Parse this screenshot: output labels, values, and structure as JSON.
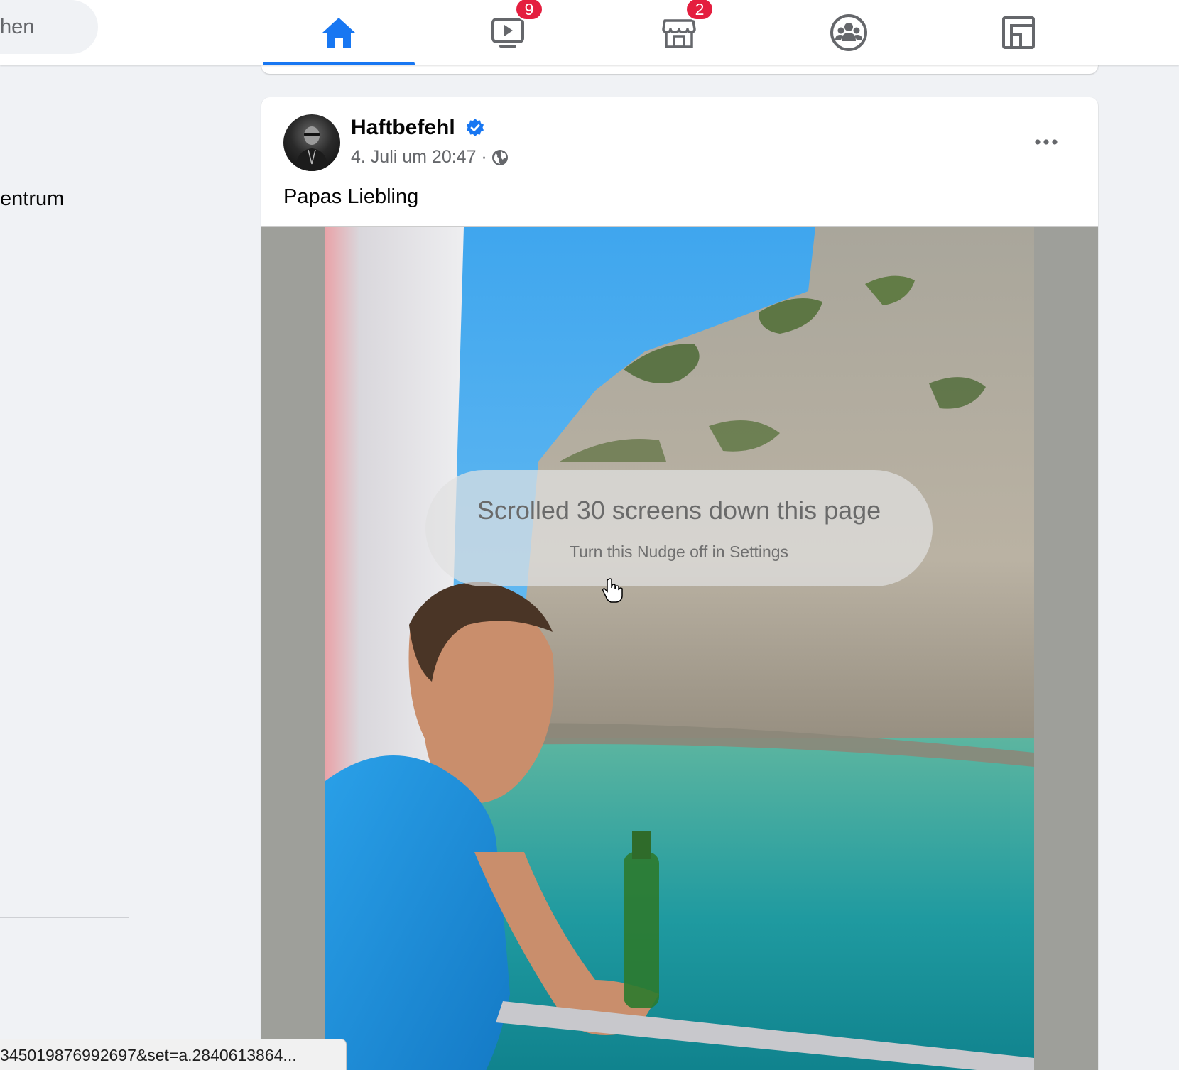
{
  "header": {
    "search_fragment": "hen",
    "tabs": [
      {
        "name": "home",
        "icon": "home-icon",
        "active": true
      },
      {
        "name": "watch",
        "icon": "video-icon",
        "badge": "9"
      },
      {
        "name": "marketplace",
        "icon": "marketplace-icon",
        "badge": "2"
      },
      {
        "name": "groups",
        "icon": "groups-icon"
      },
      {
        "name": "gaming",
        "icon": "gaming-icon"
      }
    ],
    "accent_color": "#1877f2",
    "badge_color": "#e41e3f"
  },
  "sidebar": {
    "item_fragment": "entrum"
  },
  "post": {
    "author": "Haftbefehl",
    "verified": true,
    "meta": "4. Juli um 20:47 ·",
    "audience_icon": "globe-icon",
    "text": "Papas Liebling",
    "more_icon": "more-icon"
  },
  "nudge": {
    "title": "Scrolled 30 screens down this page",
    "subtitle": "Turn this Nudge off in Settings"
  },
  "status_bar": {
    "url": "345019876992697&set=a.2840613864..."
  }
}
